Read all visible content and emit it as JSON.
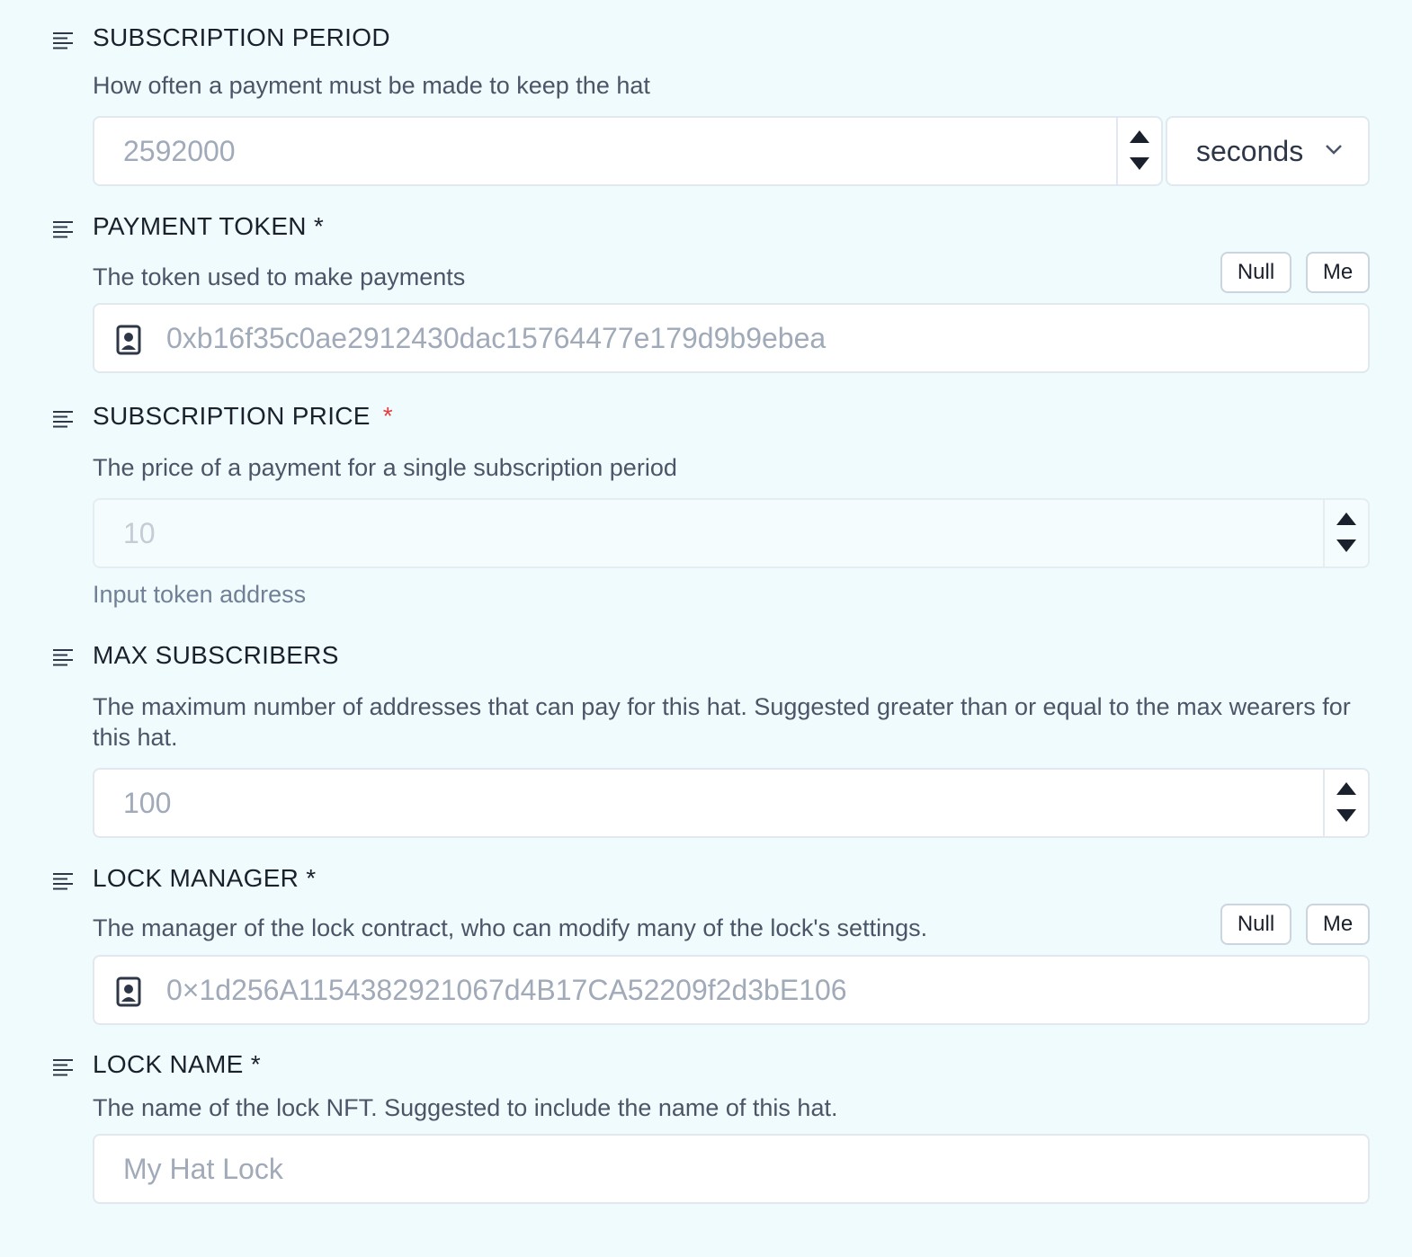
{
  "subscription_period": {
    "label": "SUBSCRIPTION PERIOD",
    "description": "How often a payment must be made to keep the hat",
    "placeholder": "2592000",
    "unit": "seconds"
  },
  "payment_token": {
    "label": "PAYMENT TOKEN *",
    "description": "The token used to make payments",
    "null_label": "Null",
    "me_label": "Me",
    "placeholder": "0xb16f35c0ae2912430dac15764477e179d9b9ebea"
  },
  "subscription_price": {
    "label": "SUBSCRIPTION PRICE",
    "required_mark": "*",
    "description": "The price of a payment for a single subscription period",
    "placeholder": "10",
    "helper": "Input token address"
  },
  "max_subscribers": {
    "label": "MAX SUBSCRIBERS",
    "description": "The maximum number of addresses that can pay for this hat. Suggested greater than or equal to the max wearers for this hat.",
    "placeholder": "100"
  },
  "lock_manager": {
    "label": "LOCK MANAGER *",
    "description": "The manager of the lock contract, who can modify many of the lock's settings.",
    "null_label": "Null",
    "me_label": "Me",
    "placeholder": "0×1d256A1154382921067d4B17CA52209f2d3bE106"
  },
  "lock_name": {
    "label": "LOCK NAME *",
    "description": "The name of the lock NFT. Suggested to include the name of this hat.",
    "placeholder": "My Hat Lock"
  },
  "colors": {
    "background": "#f0fbfd",
    "required_red": "#e53e3e",
    "border": "#e2e8f0"
  },
  "icons": {
    "field": "text-align-left-icon",
    "address": "contact-card-icon",
    "select": "chevron-down-icon"
  }
}
